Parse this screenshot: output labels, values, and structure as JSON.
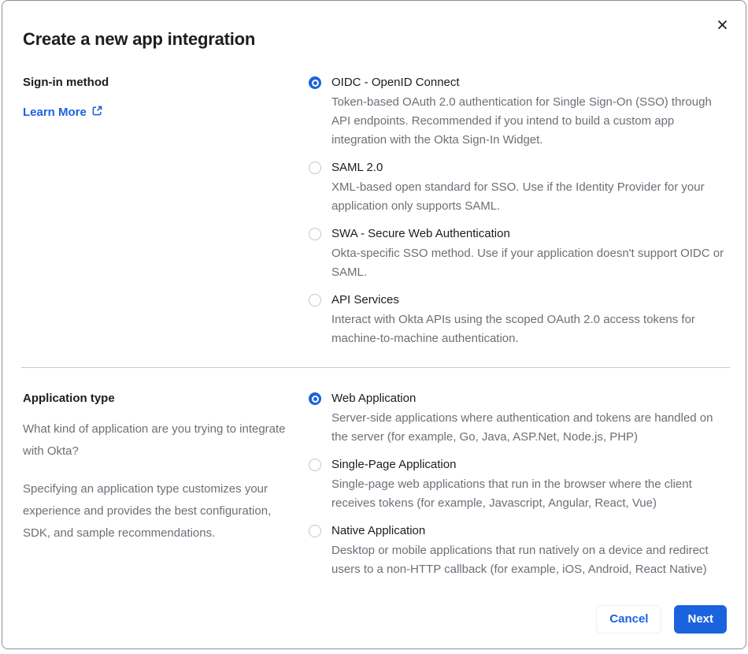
{
  "modal": {
    "title": "Create a new app integration"
  },
  "signin": {
    "heading": "Sign-in method",
    "learn_more_label": "Learn More",
    "options": [
      {
        "label": "OIDC - OpenID Connect",
        "description": "Token-based OAuth 2.0 authentication for Single Sign-On (SSO) through API endpoints. Recommended if you intend to build a custom app integration with the Okta Sign-In Widget.",
        "selected": true
      },
      {
        "label": "SAML 2.0",
        "description": "XML-based open standard for SSO. Use if the Identity Provider for your application only supports SAML.",
        "selected": false
      },
      {
        "label": "SWA - Secure Web Authentication",
        "description": "Okta-specific SSO method. Use if your application doesn't support OIDC or SAML.",
        "selected": false
      },
      {
        "label": "API Services",
        "description": "Interact with Okta APIs using the scoped OAuth 2.0 access tokens for machine-to-machine authentication.",
        "selected": false
      }
    ]
  },
  "apptype": {
    "heading": "Application type",
    "paragraph1": "What kind of application are you trying to integrate with Okta?",
    "paragraph2": "Specifying an application type customizes your experience and provides the best configuration, SDK, and sample recommendations.",
    "options": [
      {
        "label": "Web Application",
        "description": "Server-side applications where authentication and tokens are handled on the server (for example, Go, Java, ASP.Net, Node.js, PHP)",
        "selected": true
      },
      {
        "label": "Single-Page Application",
        "description": "Single-page web applications that run in the browser where the client receives tokens (for example, Javascript, Angular, React, Vue)",
        "selected": false
      },
      {
        "label": "Native Application",
        "description": "Desktop or mobile applications that run natively on a device and redirect users to a non-HTTP callback (for example, iOS, Android, React Native)",
        "selected": false
      }
    ]
  },
  "footer": {
    "cancel_label": "Cancel",
    "next_label": "Next"
  },
  "colors": {
    "accent_blue": "#1b63de",
    "text_dark": "#1d1d21",
    "text_gray": "#6e6e78",
    "modal_border": "#8e8e98",
    "divider": "#c9c9cf",
    "radio_unselected_border": "#c6c6cc"
  }
}
